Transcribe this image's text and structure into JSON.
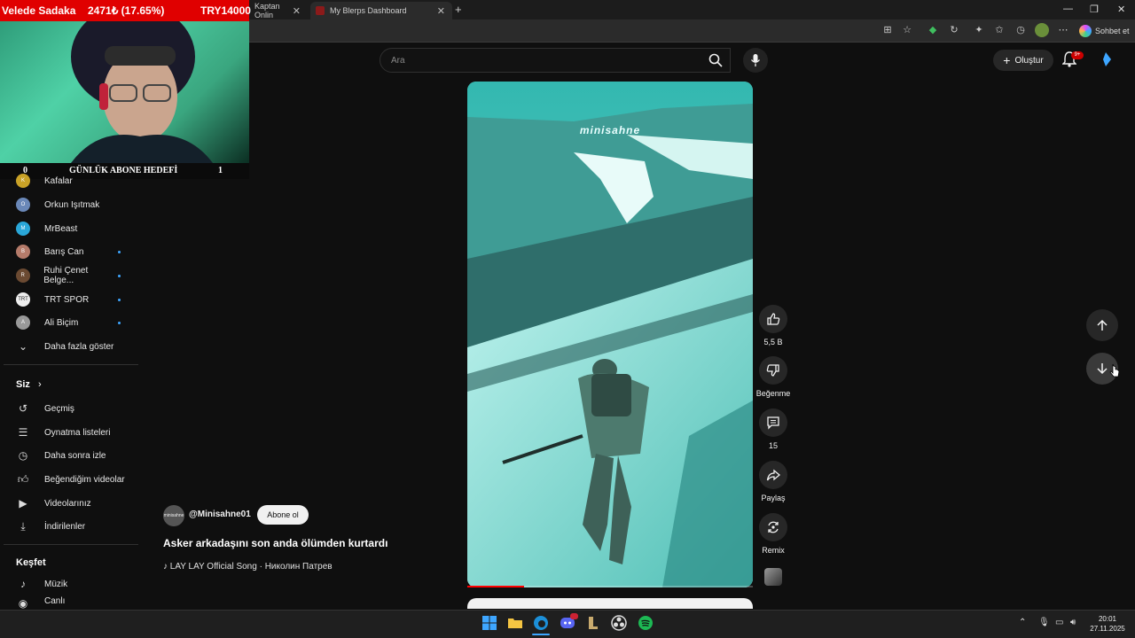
{
  "stream_overlay": {
    "donor": "Velede Sadaka",
    "change": "2471₺ (17.65%)",
    "goal": "TRY14000",
    "goal_bar_left": "0",
    "goal_bar_title": "GÜNLÜK ABONE HEDEFİ",
    "goal_bar_right": "1"
  },
  "browser": {
    "tabs": [
      {
        "label": "Kaptan Onlin"
      },
      {
        "label": "My Blerps Dashboard"
      }
    ],
    "copilot_label": "Sohbet et"
  },
  "header": {
    "search_placeholder": "Ara",
    "create_label": "Oluştur",
    "notif_count": "9+"
  },
  "sidebar": {
    "subscriptions": [
      {
        "label": "Kafalar",
        "avatar": "K",
        "dot": false
      },
      {
        "label": "Orkun Işıtmak",
        "avatar": "O",
        "dot": false
      },
      {
        "label": "MrBeast",
        "avatar": "M",
        "dot": false
      },
      {
        "label": "Barış Can",
        "avatar": "B",
        "dot": true
      },
      {
        "label": "Ruhi Çenet Belge...",
        "avatar": "R",
        "dot": true
      },
      {
        "label": "TRT SPOR",
        "avatar": "TRT",
        "dot": true
      },
      {
        "label": "Ali Biçim",
        "avatar": "A",
        "dot": true
      }
    ],
    "show_more": "Daha fazla göster",
    "you_title": "Siz",
    "you_items": [
      {
        "label": "Geçmiş",
        "icon": "history-icon"
      },
      {
        "label": "Oynatma listeleri",
        "icon": "playlist-icon"
      },
      {
        "label": "Daha sonra izle",
        "icon": "clock-icon"
      },
      {
        "label": "Beğendiğim videolar",
        "icon": "thumbs-up-icon"
      },
      {
        "label": "Videolarınız",
        "icon": "video-icon"
      },
      {
        "label": "İndirilenler",
        "icon": "download-icon"
      }
    ],
    "explore_title": "Keşfet",
    "explore_items": [
      {
        "label": "Müzik",
        "icon": "music-icon"
      },
      {
        "label": "Canlı",
        "icon": "live-icon"
      }
    ]
  },
  "short": {
    "watermark": "minisahne",
    "channel": "@Minisahne01",
    "channel_avatar": "minisahne",
    "subscribe_label": "Abone ol",
    "title": "Asker arkadaşını son anda ölümden kurtardı",
    "song": "♪ LAY LAY Official Song · Николин Патрев",
    "progress": 0.2,
    "likes": "5,5 B",
    "dislike_label": "Beğenme",
    "comments": "15",
    "share_label": "Paylaş",
    "remix_label": "Remix"
  },
  "taskbar": {
    "time": "20:01",
    "date": "27.11.2025"
  },
  "colors": {
    "brand_red": "#ff0000",
    "overlay_red": "#e00000",
    "background": "#0f0f0f"
  }
}
